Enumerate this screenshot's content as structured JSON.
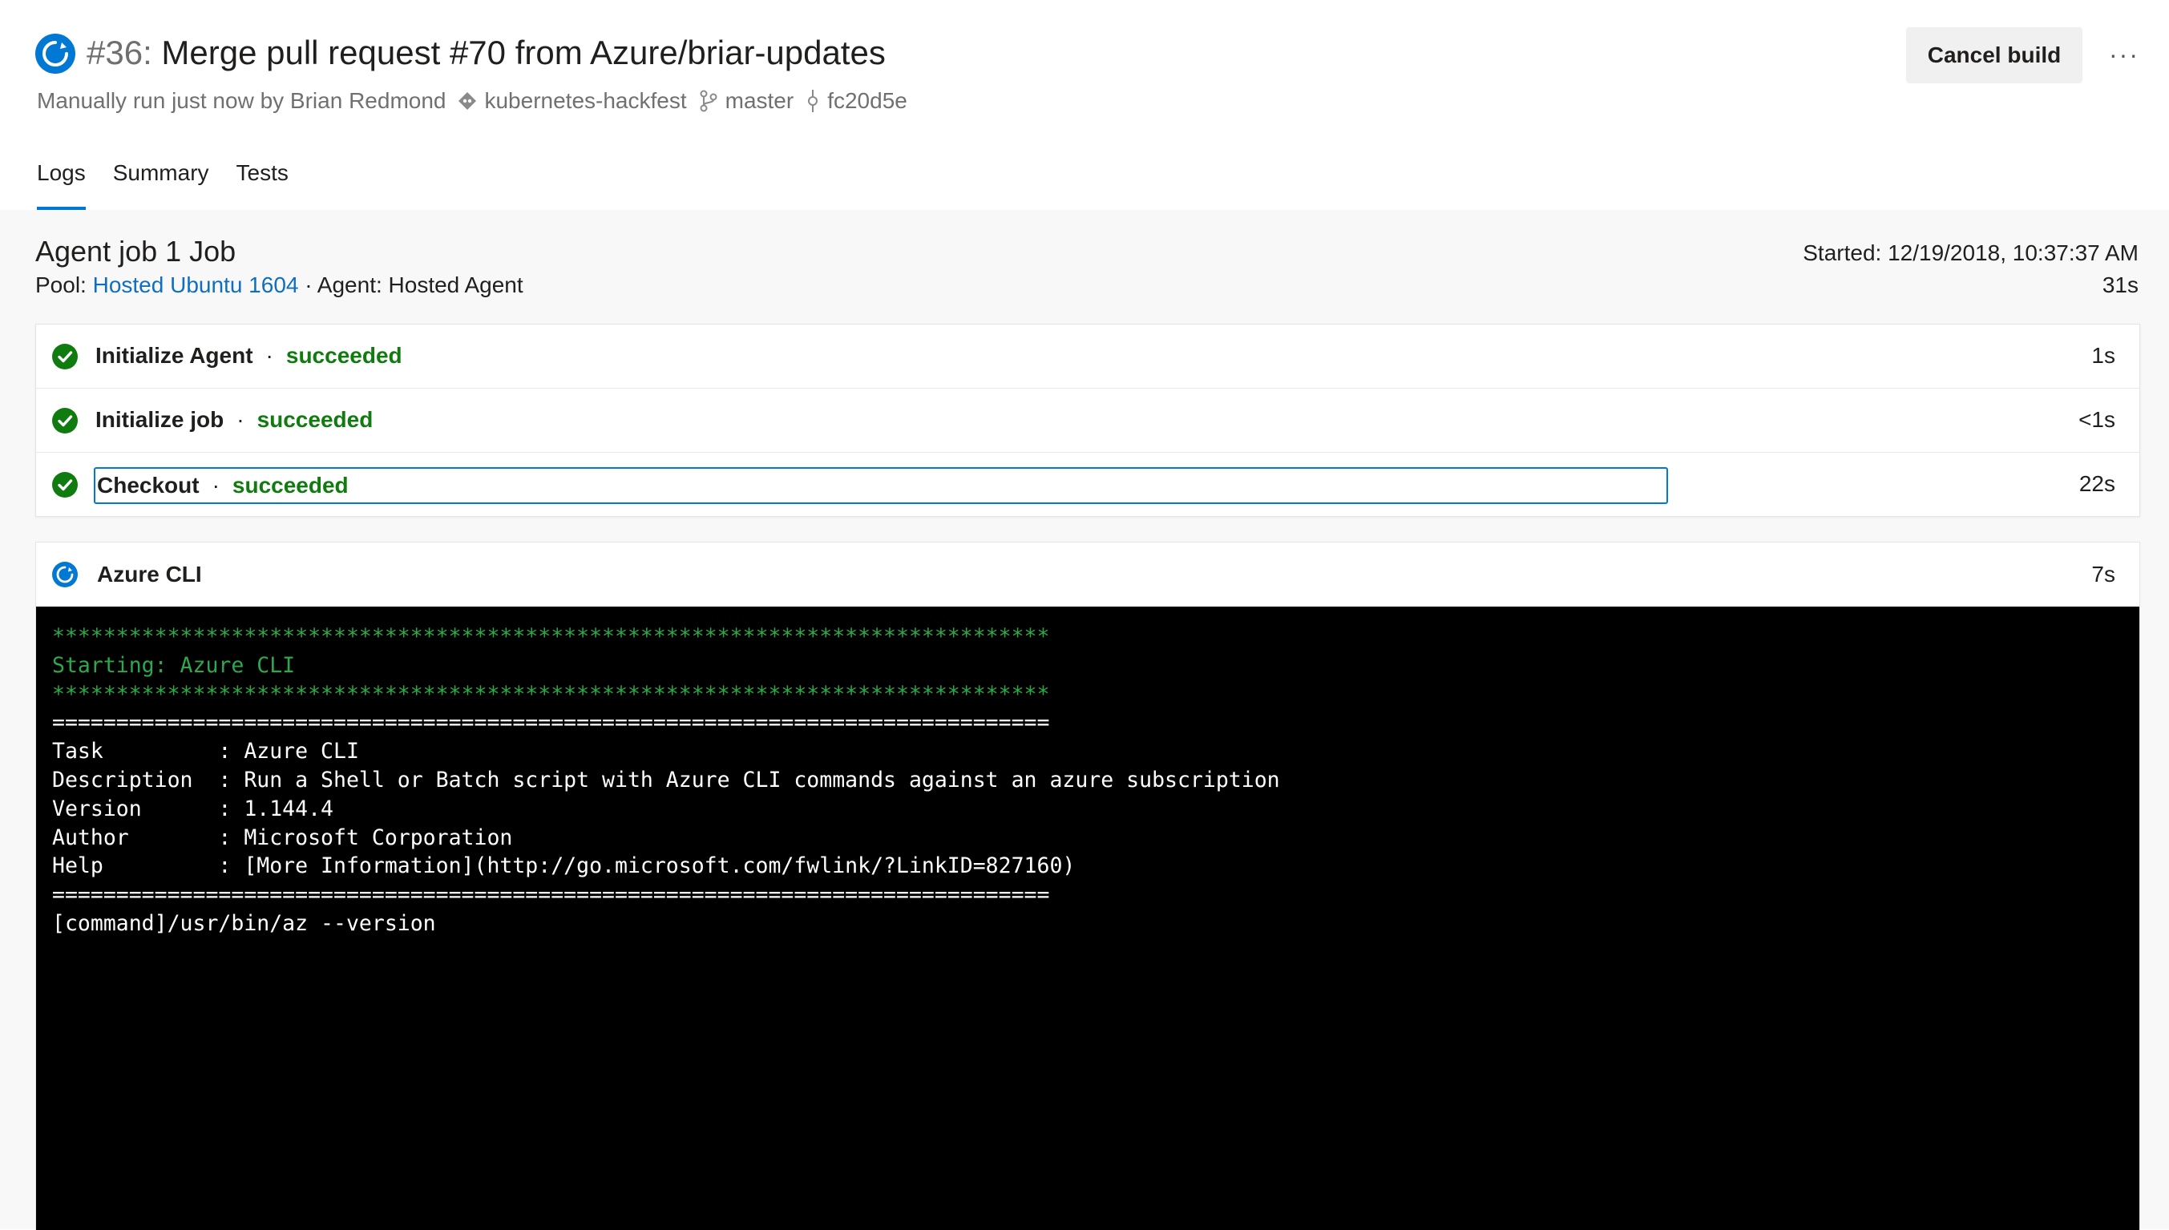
{
  "build": {
    "number": "#36:",
    "title": "Merge pull request #70 from Azure/briar-updates",
    "trigger_text": "Manually run just now by Brian Redmond",
    "repo": "kubernetes-hackfest",
    "branch": "master",
    "commit": "fc20d5e",
    "cancel_label": "Cancel build",
    "more_label": "···"
  },
  "tabs": [
    {
      "label": "Logs",
      "active": true
    },
    {
      "label": "Summary",
      "active": false
    },
    {
      "label": "Tests",
      "active": false
    }
  ],
  "job": {
    "title": "Agent job 1 Job",
    "pool_label": "Pool:",
    "pool_name": "Hosted Ubuntu 1604",
    "agent_text": "· Agent: Hosted Agent",
    "started": "Started: 12/19/2018, 10:37:37 AM",
    "duration": "31s"
  },
  "steps": [
    {
      "name": "Initialize Agent",
      "separator": "·",
      "status": "succeeded",
      "duration": "1s"
    },
    {
      "name": "Initialize job",
      "separator": "·",
      "status": "succeeded",
      "duration": "<1s"
    },
    {
      "name": "Checkout",
      "separator": "·",
      "status": "succeeded",
      "duration": "22s"
    }
  ],
  "current_step": {
    "name": "Azure CLI",
    "duration": "7s"
  },
  "console": {
    "lines": [
      "******************************************************************************",
      "Starting: Azure CLI",
      "******************************************************************************",
      "==============================================================================",
      "Task         : Azure CLI",
      "Description  : Run a Shell or Batch script with Azure CLI commands against an azure subscription",
      "Version      : 1.144.4",
      "Author       : Microsoft Corporation",
      "Help         : [More Information](http://go.microsoft.com/fwlink/?LinkID=827160)",
      "==============================================================================",
      "[command]/usr/bin/az --version"
    ]
  },
  "colors": {
    "accent": "#0078d4",
    "success": "#107c10",
    "console_green": "#2ea84a",
    "console_bg": "#000000",
    "link": "#106ebe"
  },
  "icons": {
    "run_status": "in-progress-circle-icon",
    "repo": "repo-diamond-icon",
    "branch": "branch-icon",
    "commit": "commit-icon",
    "step_done": "check-circle-icon"
  }
}
